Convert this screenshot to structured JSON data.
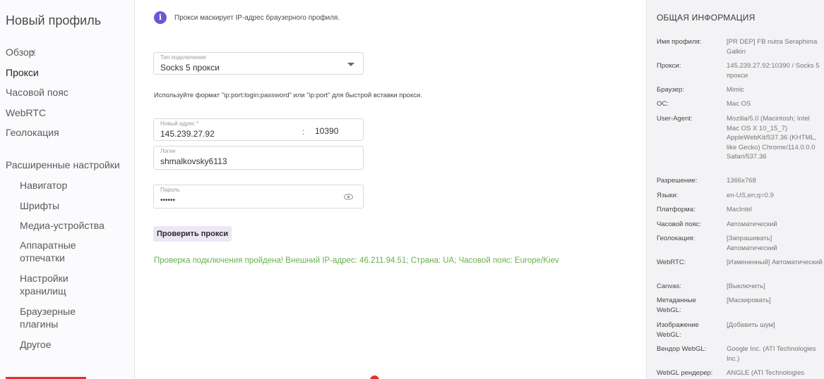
{
  "sidebar": {
    "title": "Новый профиль",
    "items": [
      {
        "label": "Обзор"
      },
      {
        "label": "Прокси"
      },
      {
        "label": "Часовой пояс"
      },
      {
        "label": "WebRTC"
      },
      {
        "label": "Геолокация"
      }
    ],
    "advanced_label": "Расширенные настройки",
    "sub_items": [
      {
        "label": "Навигатор"
      },
      {
        "label": "Шрифты"
      },
      {
        "label": "Медиа-устройства"
      },
      {
        "label": "Аппаратные отпечатки"
      },
      {
        "label": "Настройки хранилищ"
      },
      {
        "label": "Браузерные плагины"
      },
      {
        "label": "Другое"
      }
    ]
  },
  "main": {
    "info_text": "Прокси маскирует IP-адрес браузерного профиля.",
    "connection_type": {
      "label": "Тип подключения",
      "value": "Socks 5 прокси"
    },
    "hint": "Используйте формат \"ip:port:login:password\" или \"ip:port\" для быстрой вставки прокси.",
    "address": {
      "label": "Новый адрес *",
      "value": "145.239.27.92",
      "separator": ":",
      "port": "10390"
    },
    "login": {
      "label": "Логин",
      "value": "shmalkovsky6113"
    },
    "password": {
      "label": "Пароль",
      "value": "••••••"
    },
    "check_button": "Проверить прокси",
    "success_message": "Проверка подключения пройдена! Внешний IP-адрес: 46.211.94.51; Страна: UA; Часовой пояс: Europe/Kiev"
  },
  "info_panel": {
    "title": "ОБЩАЯ ИНФОРМАЦИЯ",
    "rows": [
      {
        "key": "Имя профиля:",
        "value": "[PR DEP] FB nutra Seraphima Galkin"
      },
      {
        "key": "Прокси:",
        "value": "145.239.27.92:10390 / Socks 5 прокси"
      },
      {
        "key": "Браузер:",
        "value": "Mimic"
      },
      {
        "key": "ОС:",
        "value": "Mac OS"
      },
      {
        "key": "User-Agent:",
        "value": "Mozilla/5.0 (Macintosh; Intel Mac OS X 10_15_7) AppleWebKit/537.36 (KHTML, like Gecko) Chrome/114.0.0.0 Safari/537.36"
      },
      {
        "key": "Разрешение:",
        "value": "1366x768"
      },
      {
        "key": "Языки:",
        "value": "en-US,en;q=0.9"
      },
      {
        "key": "Платформа:",
        "value": "MacIntel"
      },
      {
        "key": "Часовой пояс:",
        "value": "Автоматический"
      },
      {
        "key": "Геолокация:",
        "value": "[Запрашивать] Автоматический"
      },
      {
        "key": "WebRTC:",
        "value": "[Измененный] Автоматический"
      },
      {
        "key": "Canvas:",
        "value": "[Выключить]"
      },
      {
        "key": "Метаданные WebGL:",
        "value": "[Маскировать]"
      },
      {
        "key": "Изображение WebGL:",
        "value": "[Добавить шум]"
      },
      {
        "key": "Вендор WebGL:",
        "value": "Google Inc. (ATI Technologies Inc.)"
      },
      {
        "key": "WebGL рендерер:",
        "value": "ANGLE (ATI Technologies"
      }
    ]
  },
  "colors": {
    "accent": "#6b57d6",
    "success": "#6ab04c",
    "button_bg": "#ece7f5",
    "video_red": "#e53030"
  }
}
